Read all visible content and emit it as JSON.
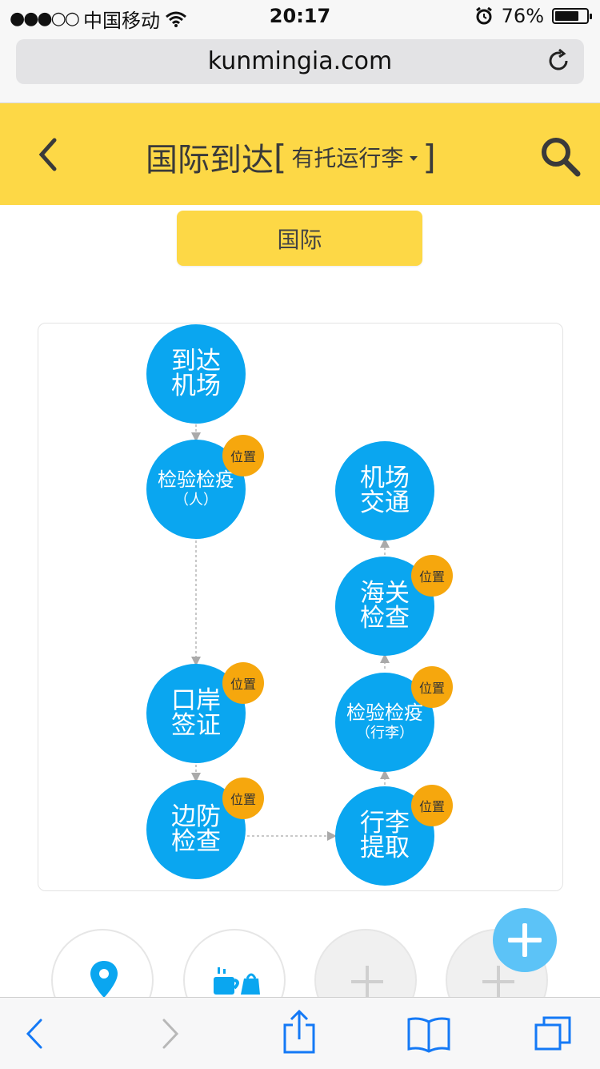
{
  "status_bar": {
    "signal_dots": "●●●○○",
    "carrier": "中国移动",
    "time": "20:17",
    "battery": "76%",
    "battery_level": 0.76,
    "icons": [
      "wifi-icon",
      "alarm-icon",
      "battery-icon"
    ]
  },
  "browser": {
    "url": "kunmingia.com",
    "toolbar_icons": [
      "back-icon",
      "forward-icon",
      "share-icon",
      "bookmarks-icon",
      "tabs-icon"
    ]
  },
  "header": {
    "title": "国际到达",
    "bracket_open": "[",
    "filter_label": "有托运行李",
    "bracket_close": "]",
    "background": "#fdd846"
  },
  "category_chip": {
    "label": "国际"
  },
  "flow": {
    "node_color": "#0aa6f0",
    "badge_color": "#f6a70d",
    "badge_label": "位置",
    "nodes": [
      {
        "line1": "到达",
        "line2": "机场"
      },
      {
        "line1": "检验检疫",
        "line2": "（人）"
      },
      {
        "line1": "口岸",
        "line2": "签证"
      },
      {
        "line1": "边防",
        "line2": "检查"
      },
      {
        "line1": "行李",
        "line2": "提取"
      },
      {
        "line1": "检验检疫",
        "line2": "（行李）"
      },
      {
        "line1": "海关",
        "line2": "检查"
      },
      {
        "line1": "机场",
        "line2": "交通"
      }
    ]
  },
  "quick_actions": [
    {
      "icon": "location-pin-icon"
    },
    {
      "icon": "shopping-icon"
    },
    {
      "icon": "plus-icon"
    },
    {
      "icon": "plus-icon"
    }
  ],
  "fab": {
    "icon": "plus-icon",
    "color": "#5cc3f7"
  }
}
